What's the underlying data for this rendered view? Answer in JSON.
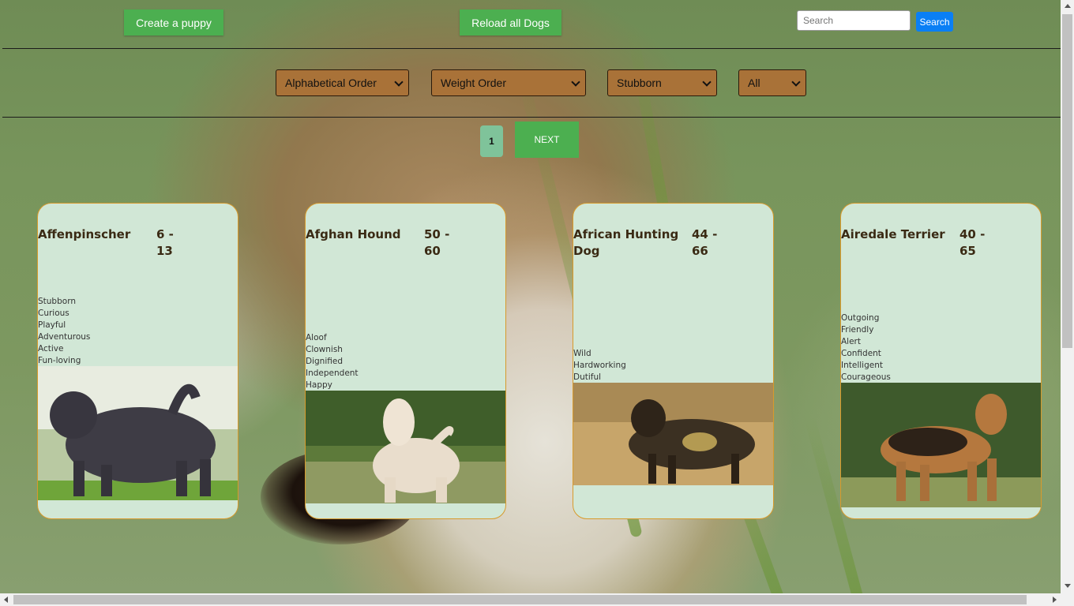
{
  "toolbar": {
    "create_label": "Create a puppy",
    "reload_label": "Reload all Dogs",
    "search_placeholder": "Search",
    "search_button": "Search"
  },
  "filters": {
    "alphabetical": "Alphabetical Order",
    "weight": "Weight Order",
    "temperament": "Stubborn",
    "origin": "All"
  },
  "pagination": {
    "current_page": "1",
    "next_label": "NEXT"
  },
  "cards": [
    {
      "name": "Affenpinscher",
      "weight": "6 - 13",
      "temperaments": [
        "Stubborn",
        "Curious",
        "Playful",
        "Adventurous",
        "Active",
        "Fun-loving"
      ]
    },
    {
      "name": "Afghan Hound",
      "weight": "50 - 60",
      "temperaments": [
        "Aloof",
        "Clownish",
        "Dignified",
        "Independent",
        "Happy"
      ]
    },
    {
      "name": "African Hunting Dog",
      "weight": "44 - 66",
      "temperaments": [
        "Wild",
        "Hardworking",
        "Dutiful"
      ]
    },
    {
      "name": "Airedale Terrier",
      "weight": "40 - 65",
      "temperaments": [
        "Outgoing",
        "Friendly",
        "Alert",
        "Confident",
        "Intelligent",
        "Courageous"
      ]
    }
  ],
  "colors": {
    "green_button": "#4caf50",
    "search_blue": "#0a7ff5",
    "select_brown": "#a97238",
    "card_bg": "#d1e7d6",
    "card_border": "#d79a2c"
  }
}
